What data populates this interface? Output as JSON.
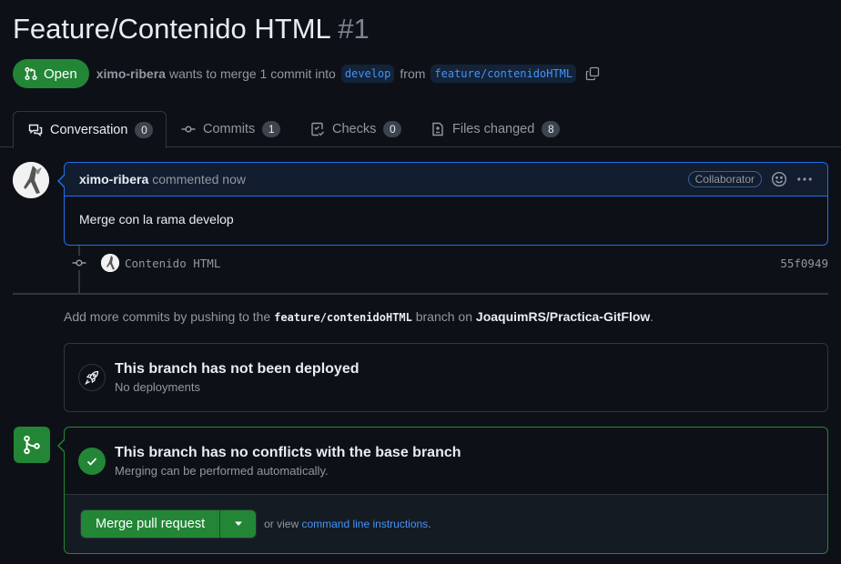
{
  "pr": {
    "title": "Feature/Contenido HTML",
    "number": "#1",
    "state": "Open",
    "author": "ximo-ribera",
    "merge_text_1": "wants to merge 1 commit into",
    "base_branch": "develop",
    "merge_text_2": "from",
    "head_branch": "feature/contenidoHTML"
  },
  "tabs": [
    {
      "label": "Conversation",
      "count": "0",
      "icon": "comment-discussion-icon"
    },
    {
      "label": "Commits",
      "count": "1",
      "icon": "git-commit-icon"
    },
    {
      "label": "Checks",
      "count": "0",
      "icon": "checklist-icon"
    },
    {
      "label": "Files changed",
      "count": "8",
      "icon": "file-diff-icon"
    }
  ],
  "comment": {
    "author": "ximo-ribera",
    "time": "commented now",
    "role_badge": "Collaborator",
    "body": "Merge con la rama develop"
  },
  "commit": {
    "message": "Contenido HTML",
    "sha": "55f0949"
  },
  "push_hint": {
    "prefix": "Add more commits by pushing to the",
    "branch": "feature/contenidoHTML",
    "middle": "branch on",
    "repo": "JoaquimRS/Practica-GitFlow",
    "suffix": "."
  },
  "deploy": {
    "title": "This branch has not been deployed",
    "subtitle": "No deployments"
  },
  "merge": {
    "title": "This branch has no conflicts with the base branch",
    "subtitle": "Merging can be performed automatically.",
    "button": "Merge pull request",
    "or_view": "or view",
    "link": "command line instructions",
    "period": "."
  },
  "colors": {
    "accent_green": "#238636",
    "accent_blue": "#1f6feb",
    "link_blue": "#4493f8",
    "bg": "#0d1117"
  }
}
